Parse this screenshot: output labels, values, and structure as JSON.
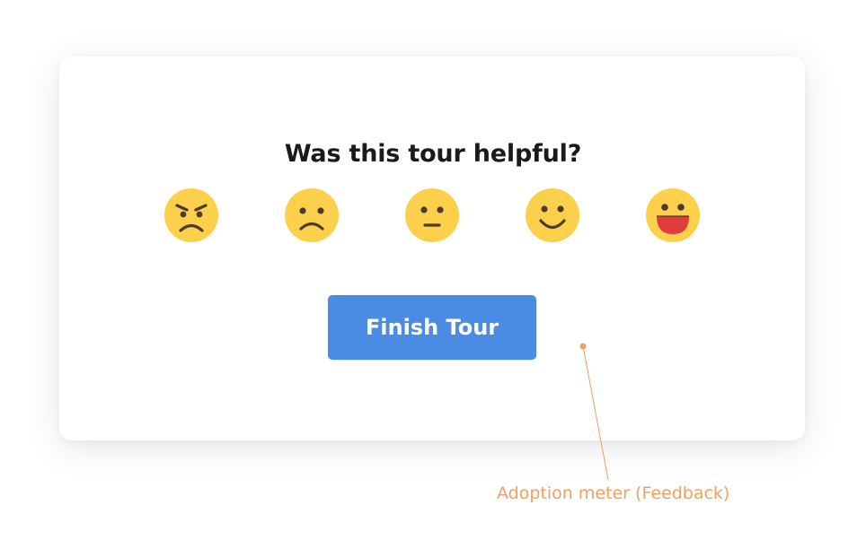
{
  "dialog": {
    "question": "Was this tour helpful?",
    "finish_label": "Finish Tour"
  },
  "rating": {
    "options": [
      "angry",
      "sad",
      "neutral",
      "smile",
      "happy"
    ],
    "face_color": "#fcd04b",
    "feature_color": "#4a3b2c",
    "tongue_color": "#e23b3b"
  },
  "annotation": {
    "label": "Adoption meter (Feedback)",
    "color": "#f0a060"
  },
  "colors": {
    "button": "#4a8ce3",
    "text": "#1a1a1a"
  }
}
